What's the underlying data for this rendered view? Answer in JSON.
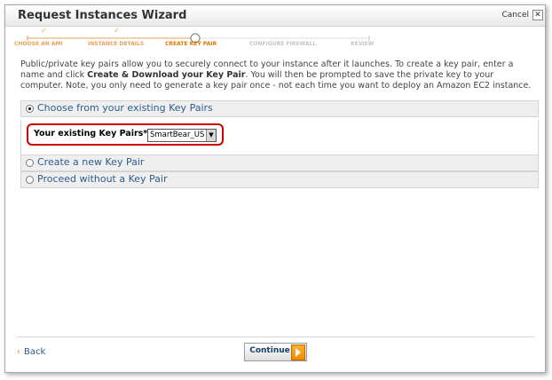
{
  "window": {
    "title": "Request Instances Wizard",
    "cancel_label": "Cancel",
    "close_glyph": "✕"
  },
  "steps": [
    {
      "label": "CHOOSE AN AMI",
      "state": "done",
      "check": "✓"
    },
    {
      "label": "INSTANCE DETAILS",
      "state": "done",
      "check": "✓"
    },
    {
      "label": "CREATE KEY PAIR",
      "state": "current"
    },
    {
      "label": "CONFIGURE FIREWALL",
      "state": "upcoming"
    },
    {
      "label": "REVIEW",
      "state": "upcoming"
    }
  ],
  "intro": {
    "part1": "Public/private key pairs allow you to securely connect to your instance after it launches. To create a key pair, enter a name and click ",
    "bold": "Create & Download your Key Pair",
    "part2": ". You will then be prompted to save the private key to your computer. Note, you only need to generate a key pair once - not each time you want to deploy an Amazon EC2 instance."
  },
  "options": [
    {
      "label": "Choose from your existing Key Pairs",
      "selected": true
    },
    {
      "label": "Create a new Key Pair",
      "selected": false
    },
    {
      "label": "Proceed without a Key Pair",
      "selected": false
    }
  ],
  "existing_key": {
    "label": "Your existing Key Pairs*:",
    "selected_value": "SmartBear_US"
  },
  "footer": {
    "back_label": "Back",
    "back_glyph": "‹",
    "continue_label": "Continue"
  },
  "colors": {
    "step_done": "#e8a05a",
    "step_current": "#e07b00",
    "step_upcoming": "#c4c4c4",
    "link": "#2d5d8c",
    "highlight": "#cc0000",
    "accent": "#f08a00"
  }
}
